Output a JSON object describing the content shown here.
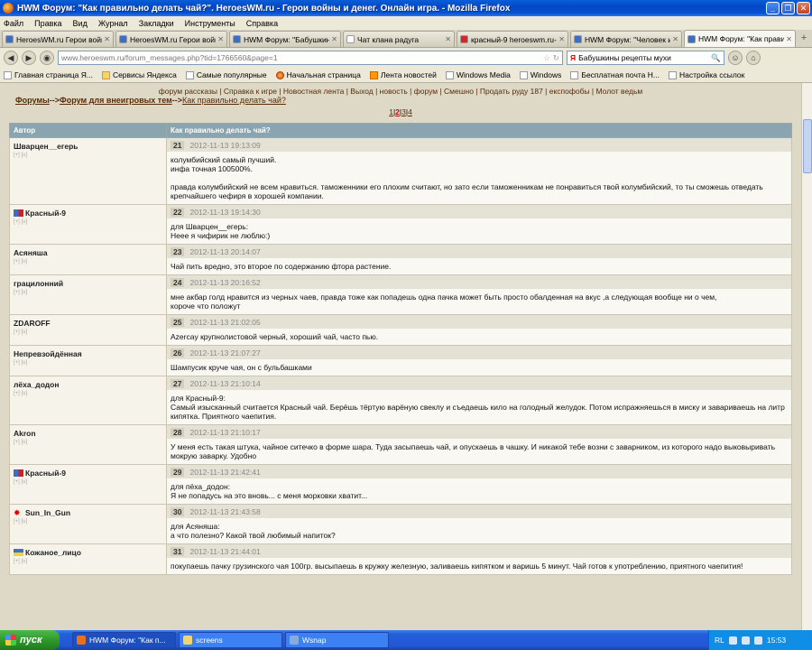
{
  "window": {
    "title": "HWM Форум: \"Как правильно делать чай?\". HeroesWM.ru - Герои войны и денег. Онлайн игра. - Mozilla Firefox"
  },
  "menubar": [
    "Файл",
    "Правка",
    "Вид",
    "Журнал",
    "Закладки",
    "Инструменты",
    "Справка"
  ],
  "tabs": [
    {
      "label": "HeroesWM.ru Герои войн...",
      "icon_color": "#3a6fc8"
    },
    {
      "label": "HeroesWM.ru Герои войн...",
      "icon_color": "#3a6fc8"
    },
    {
      "label": "HWM Форум: \"Бабушкин...",
      "icon_color": "#3a6fc8"
    },
    {
      "label": "Чат клана радуга",
      "icon_color": "#ffffff"
    },
    {
      "label": "красный-9 heroeswm.ru-...",
      "icon_color": "#d22"
    },
    {
      "label": "HWM Форум: \"Человек и...",
      "icon_color": "#3a6fc8"
    },
    {
      "label": "HWM Форум: \"Как прави...",
      "icon_color": "#3a6fc8",
      "active": true
    }
  ],
  "nav": {
    "url": "www.heroeswm.ru/forum_messages.php?tid=1766560&page=1",
    "search_value": "Бабушкины рецепты мухи"
  },
  "bookmarks": [
    {
      "label": "Главная страница Я...",
      "icon": "page"
    },
    {
      "label": "Сервисы Яндекса",
      "icon": "folder"
    },
    {
      "label": "Самые популярные",
      "icon": "page"
    },
    {
      "label": "Начальная страница",
      "icon": "ff"
    },
    {
      "label": "Лента новостей",
      "icon": "rss"
    },
    {
      "label": "Windows Media",
      "icon": "page"
    },
    {
      "label": "Windows",
      "icon": "page"
    },
    {
      "label": "Бесплатная почта H...",
      "icon": "page"
    },
    {
      "label": "Настройка ссылок",
      "icon": "page"
    }
  ],
  "page": {
    "toplinks": "форум рассказы | Справка к игре | Новостная лента | Выход | новость | форум | Смешно | Продать руду 187 | експофобы | Молот ведьм",
    "crumbs": {
      "forums": "Форумы",
      "sep1": "-->",
      "forum": "Форум для внеигровых тем",
      "sep2": "-->",
      "topic": "Как правильно делать чай?"
    },
    "pages": [
      "1",
      "2",
      "3",
      "4"
    ],
    "current_page": "2",
    "col_author": "Автор",
    "col_topic": "Как правильно делать чай?"
  },
  "posts": [
    {
      "author": "Шварцен__егерь",
      "flag": "",
      "num": "21",
      "date": "2012-11-13 19:13:09",
      "text": [
        "колумбийский самый пучший.",
        "инфа точная 100500%.",
        "",
        "правда колумбийский не всем нравиться. таможенники его плохим считают, но зато если таможенникам не понравиться твой колумбийский, то ты сможешь отведать крепчайшего чефиря в хорошей компании."
      ]
    },
    {
      "author": "Красный-9",
      "flag": "clan",
      "num": "22",
      "date": "2012-11-13 19:14:30",
      "text": [
        "для Шварцен__егерь:",
        "Неее я чифирик не люблю:)"
      ]
    },
    {
      "author": "Асяняша",
      "flag": "",
      "num": "23",
      "date": "2012-11-13 20:14:07",
      "text": [
        "Чай пить вредно, это второе по содержанию фтора растение."
      ]
    },
    {
      "author": "грацилонний",
      "flag": "",
      "num": "24",
      "date": "2012-11-13 20:16:52",
      "text": [
        "мне акбар голд нравится из черных чаев, правда тоже как попадешь одна пачка может быть просто обалденная на вкус ,а следующая вообще ни о чем,",
        "короче что положут"
      ]
    },
    {
      "author": "ZDAROFF",
      "flag": "",
      "num": "25",
      "date": "2012-11-13 21:02:05",
      "text": [
        "Azercay крупнолистовой черный, хороший чай, часто пью."
      ]
    },
    {
      "author": "Непревзойдённая",
      "flag": "",
      "num": "26",
      "date": "2012-11-13 21:07:27",
      "text": [
        "Шампусик круче чая, он с бульбашками"
      ]
    },
    {
      "author": "лёха_додон",
      "flag": "",
      "num": "27",
      "date": "2012-11-13 21:10:14",
      "text": [
        "для Красный-9:",
        "Самый изысканный считается Красный чай. Берёшь тёртую варёную свеклу и съедаешь кило на голодный желудок. Потом испражняешься в миску и завариваешь на литр кипятка. Приятного чаепития."
      ]
    },
    {
      "author": "Akron",
      "flag": "",
      "num": "28",
      "date": "2012-11-13 21:10:17",
      "text": [
        "У меня есть такая штука, чайное ситечко в форме шара. Туда засыпаешь чай, и опускаешь в чашку. И никакой тебе возни с заварником, из которого надо выковыривать мокрую заварку. Удобно"
      ]
    },
    {
      "author": "Красный-9",
      "flag": "clan",
      "num": "29",
      "date": "2012-11-13 21:42:41",
      "text": [
        "для пёха_додон:",
        "Я не попадусь на это вновь... с меня морковки хватит..."
      ]
    },
    {
      "author": "Sun_In_Gun",
      "flag": "star",
      "num": "30",
      "date": "2012-11-13 21:43:58",
      "text": [
        "для Асяняша:",
        "а что полезно? Какой твой любимый напиток?"
      ]
    },
    {
      "author": "Кожаное_лицо",
      "flag": "ua",
      "num": "31",
      "date": "2012-11-13 21:44:01",
      "text": [
        "покупаешь пачку грузинского чая 100гр. высыпаешь в кружку железную, заливаешь кипятком и варишь 5 минут. Чай готов к употреблению, приятного чаепития!"
      ]
    }
  ],
  "taskbar": {
    "start": "пуск",
    "tasks": [
      {
        "label": "HWM Форум: \"Как п...",
        "icon_color": "#e87020",
        "active": true
      },
      {
        "label": "screens",
        "icon_color": "#f5d46b"
      },
      {
        "label": "Wsnap",
        "icon_color": "#88aadd"
      }
    ],
    "lang": "RL",
    "clock": "15:53"
  }
}
